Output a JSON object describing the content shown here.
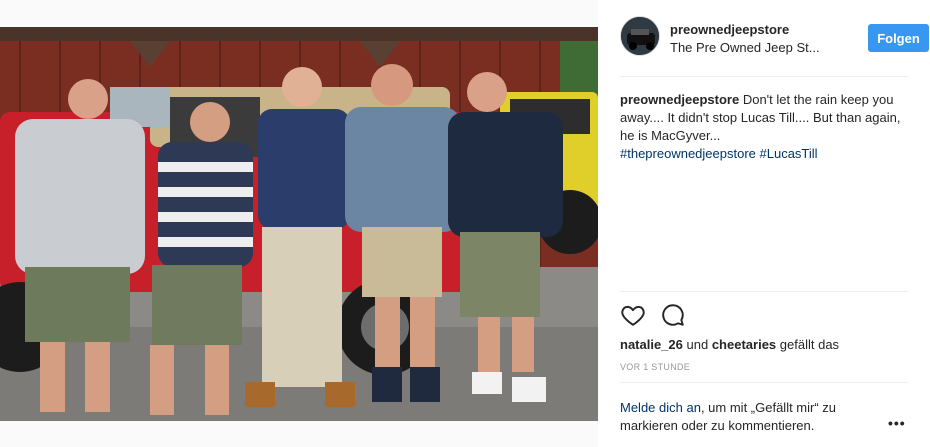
{
  "post": {
    "username": "preownedjeepstore",
    "location": "The Pre Owned Jeep St...",
    "follow_label": "Folgen",
    "caption": {
      "username": "preownedjeepstore",
      "text": "Don't let the rain keep you away.... It didn't stop Lucas Till.... But than again, he is MacGyver...",
      "hashtags": [
        "#thepreownedjeepstore",
        "#LucasTill"
      ]
    },
    "likes": {
      "user1": "natalie_26",
      "connector": "und",
      "user2": "cheetaries",
      "suffix": "gefällt das"
    },
    "timestamp": "VOR 1 STUNDE",
    "login": {
      "link": "Melde dich an",
      "text": ", um mit „Gefällt mir“ zu markieren oder zu kommentieren."
    },
    "more_label": "•••"
  },
  "icons": [
    "heart-icon",
    "comment-icon",
    "more-options-icon"
  ],
  "colors": {
    "follow_button": "#3897f0",
    "hashtag": "#003569",
    "timestamp": "#999999"
  }
}
